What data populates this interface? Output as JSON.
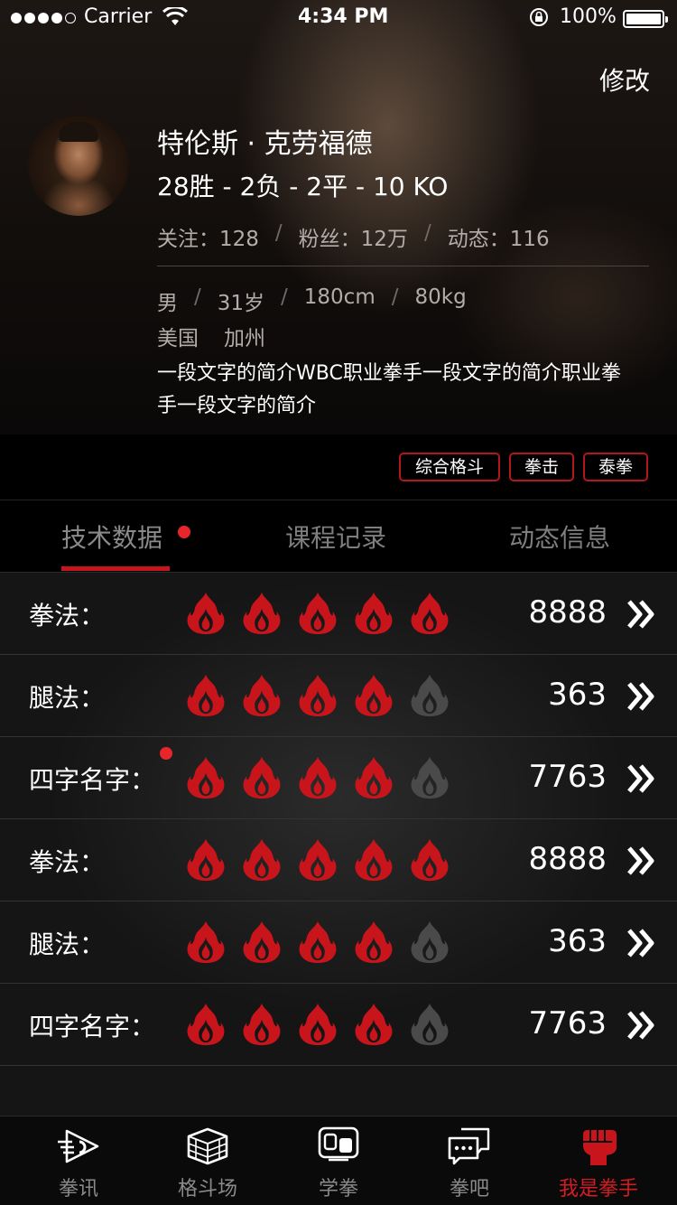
{
  "status_bar": {
    "carrier": "Carrier",
    "time": "4:34 PM",
    "battery": "100%"
  },
  "header": {
    "edit_label": "修改"
  },
  "profile": {
    "name": "特伦斯 · 克劳福德",
    "record": "28胜 - 2负 - 2平 - 10 KO",
    "stats": {
      "following": "关注：128",
      "fans": "粉丝：12万",
      "posts": "动态：116"
    },
    "info": {
      "gender": "男",
      "age": "31岁",
      "height": "180cm",
      "weight": "80kg",
      "country": "美国",
      "region": "加州"
    },
    "bio": "一段文字的简介WBC职业拳手一段文字的简介职业拳手一段文字的简介",
    "tags": [
      "综合格斗",
      "拳击",
      "泰拳"
    ]
  },
  "tabs": [
    {
      "label": "技术数据",
      "active": true,
      "has_dot": true
    },
    {
      "label": "课程记录",
      "active": false
    },
    {
      "label": "动态信息",
      "active": false
    }
  ],
  "skills": [
    {
      "label": "拳法：",
      "rating": 5,
      "value": "8888",
      "has_dot": false
    },
    {
      "label": "腿法：",
      "rating": 4,
      "value": "363",
      "has_dot": false
    },
    {
      "label": "四字名字：",
      "rating": 4,
      "value": "7763",
      "has_dot": true
    },
    {
      "label": "拳法：",
      "rating": 5,
      "value": "8888",
      "has_dot": false
    },
    {
      "label": "腿法：",
      "rating": 4,
      "value": "363",
      "has_dot": false
    },
    {
      "label": "四字名字：",
      "rating": 4,
      "value": "7763",
      "has_dot": false
    }
  ],
  "skill_max_rating": 5,
  "tabbar": [
    {
      "label": "拳讯",
      "icon": "news-icon",
      "active": false
    },
    {
      "label": "格斗场",
      "icon": "ring-icon",
      "active": false
    },
    {
      "label": "学拳",
      "icon": "learn-icon",
      "active": false
    },
    {
      "label": "拳吧",
      "icon": "chat-icon",
      "active": false
    },
    {
      "label": "我是拳手",
      "icon": "fist-icon",
      "active": true
    }
  ],
  "colors": {
    "accent": "#c8151c",
    "flame_on": "#c8151c",
    "flame_off": "#4a4a4a",
    "dot": "#e8252b"
  }
}
